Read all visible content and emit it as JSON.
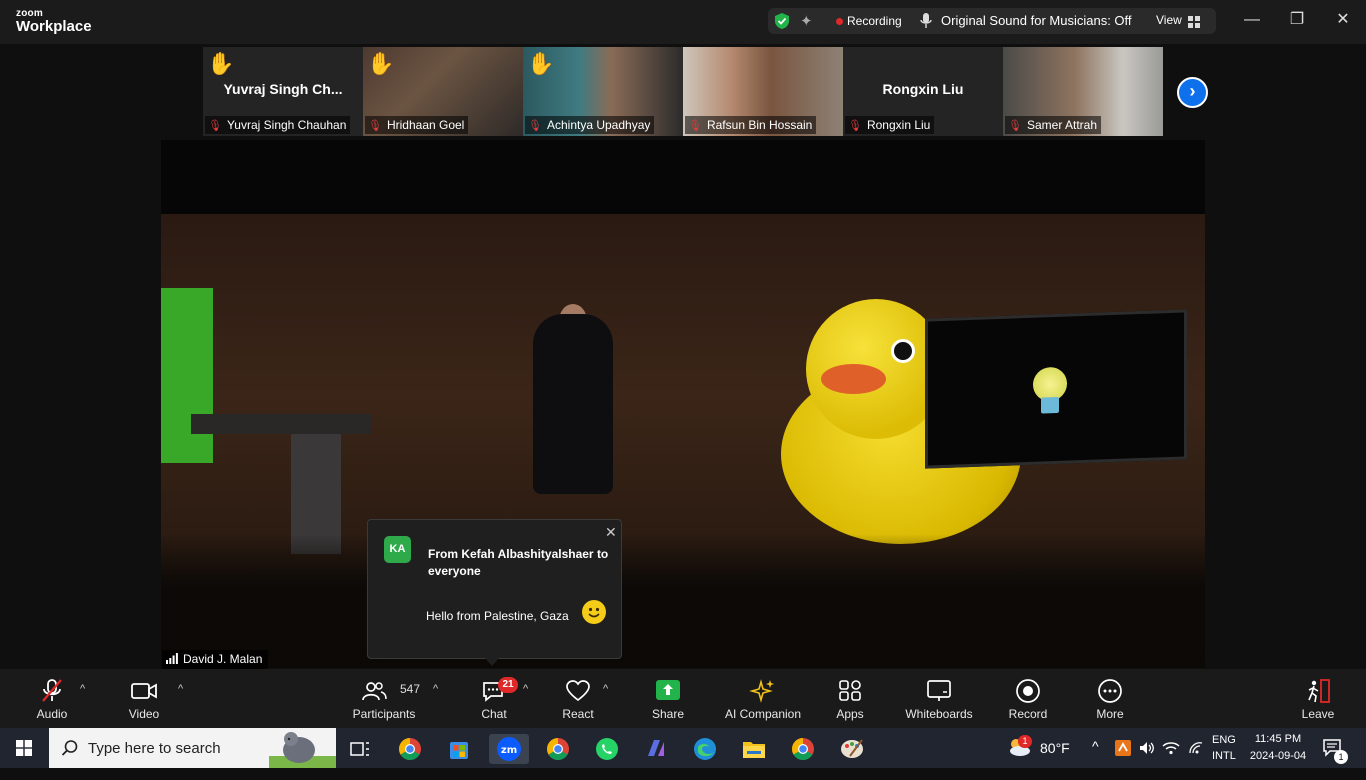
{
  "app": {
    "brand_small": "zoom",
    "brand_big": "Workplace"
  },
  "status": {
    "recording": "Recording",
    "original_sound": "Original Sound for Musicians: Off",
    "view": "View",
    "colors": {
      "record": "#e02828",
      "shield": "#22b34a"
    }
  },
  "window_controls": {
    "minimize": "—",
    "restore": "❐",
    "close": "✕"
  },
  "participants_strip": [
    {
      "name": "Yuvraj Singh Chauhan",
      "display": "Yuvraj Singh Ch...",
      "hand_raised": true,
      "video": false
    },
    {
      "name": "Hridhaan Goel",
      "hand_raised": true,
      "video": true
    },
    {
      "name": "Achintya Upadhyay",
      "hand_raised": true,
      "video": true
    },
    {
      "name": "Rafsun Bin Hossain",
      "hand_raised": false,
      "video": true
    },
    {
      "name": "Rongxin Liu",
      "display": "Rongxin Liu",
      "hand_raised": false,
      "video": false
    },
    {
      "name": "Samer Attrah",
      "hand_raised": false,
      "video": true
    }
  ],
  "speaker": {
    "name": "David J. Malan"
  },
  "chat_toast": {
    "initials": "KA",
    "from": "From Kefah Albashityalshaer to everyone",
    "message": "Hello from Palestine, Gaza"
  },
  "toolbar": {
    "audio": "Audio",
    "video": "Video",
    "participants": "Participants",
    "participants_count": "547",
    "chat": "Chat",
    "chat_badge": "21",
    "react": "React",
    "share": "Share",
    "ai": "AI Companion",
    "apps": "Apps",
    "whiteboards": "Whiteboards",
    "record": "Record",
    "more": "More",
    "leave": "Leave"
  },
  "taskbar": {
    "search_placeholder": "Type here to search",
    "weather": "80°F",
    "weather_badge": "1",
    "lang_top": "ENG",
    "lang_bottom": "INTL",
    "time": "11:45 PM",
    "date": "2024-09-04",
    "notif_count": "1"
  }
}
